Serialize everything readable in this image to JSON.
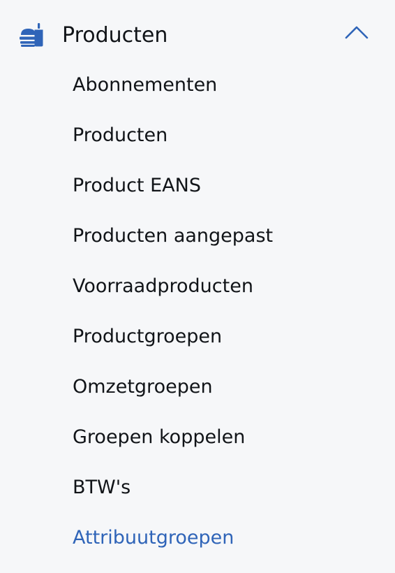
{
  "colors": {
    "background": "#f6f7f9",
    "text": "#111418",
    "accent": "#2f64b8",
    "icon": "#2f64b8"
  },
  "section": {
    "title": "Producten",
    "icon": "food-tray-icon",
    "chevron_icon": "chevron-up-icon",
    "expanded": true
  },
  "items": [
    {
      "label": "Abonnementen",
      "active": false
    },
    {
      "label": "Producten",
      "active": false
    },
    {
      "label": "Product EANS",
      "active": false
    },
    {
      "label": "Producten aangepast",
      "active": false
    },
    {
      "label": "Voorraadproducten",
      "active": false
    },
    {
      "label": "Productgroepen",
      "active": false
    },
    {
      "label": "Omzetgroepen",
      "active": false
    },
    {
      "label": "Groepen koppelen",
      "active": false
    },
    {
      "label": "BTW's",
      "active": false
    },
    {
      "label": "Attribuutgroepen",
      "active": true
    }
  ]
}
